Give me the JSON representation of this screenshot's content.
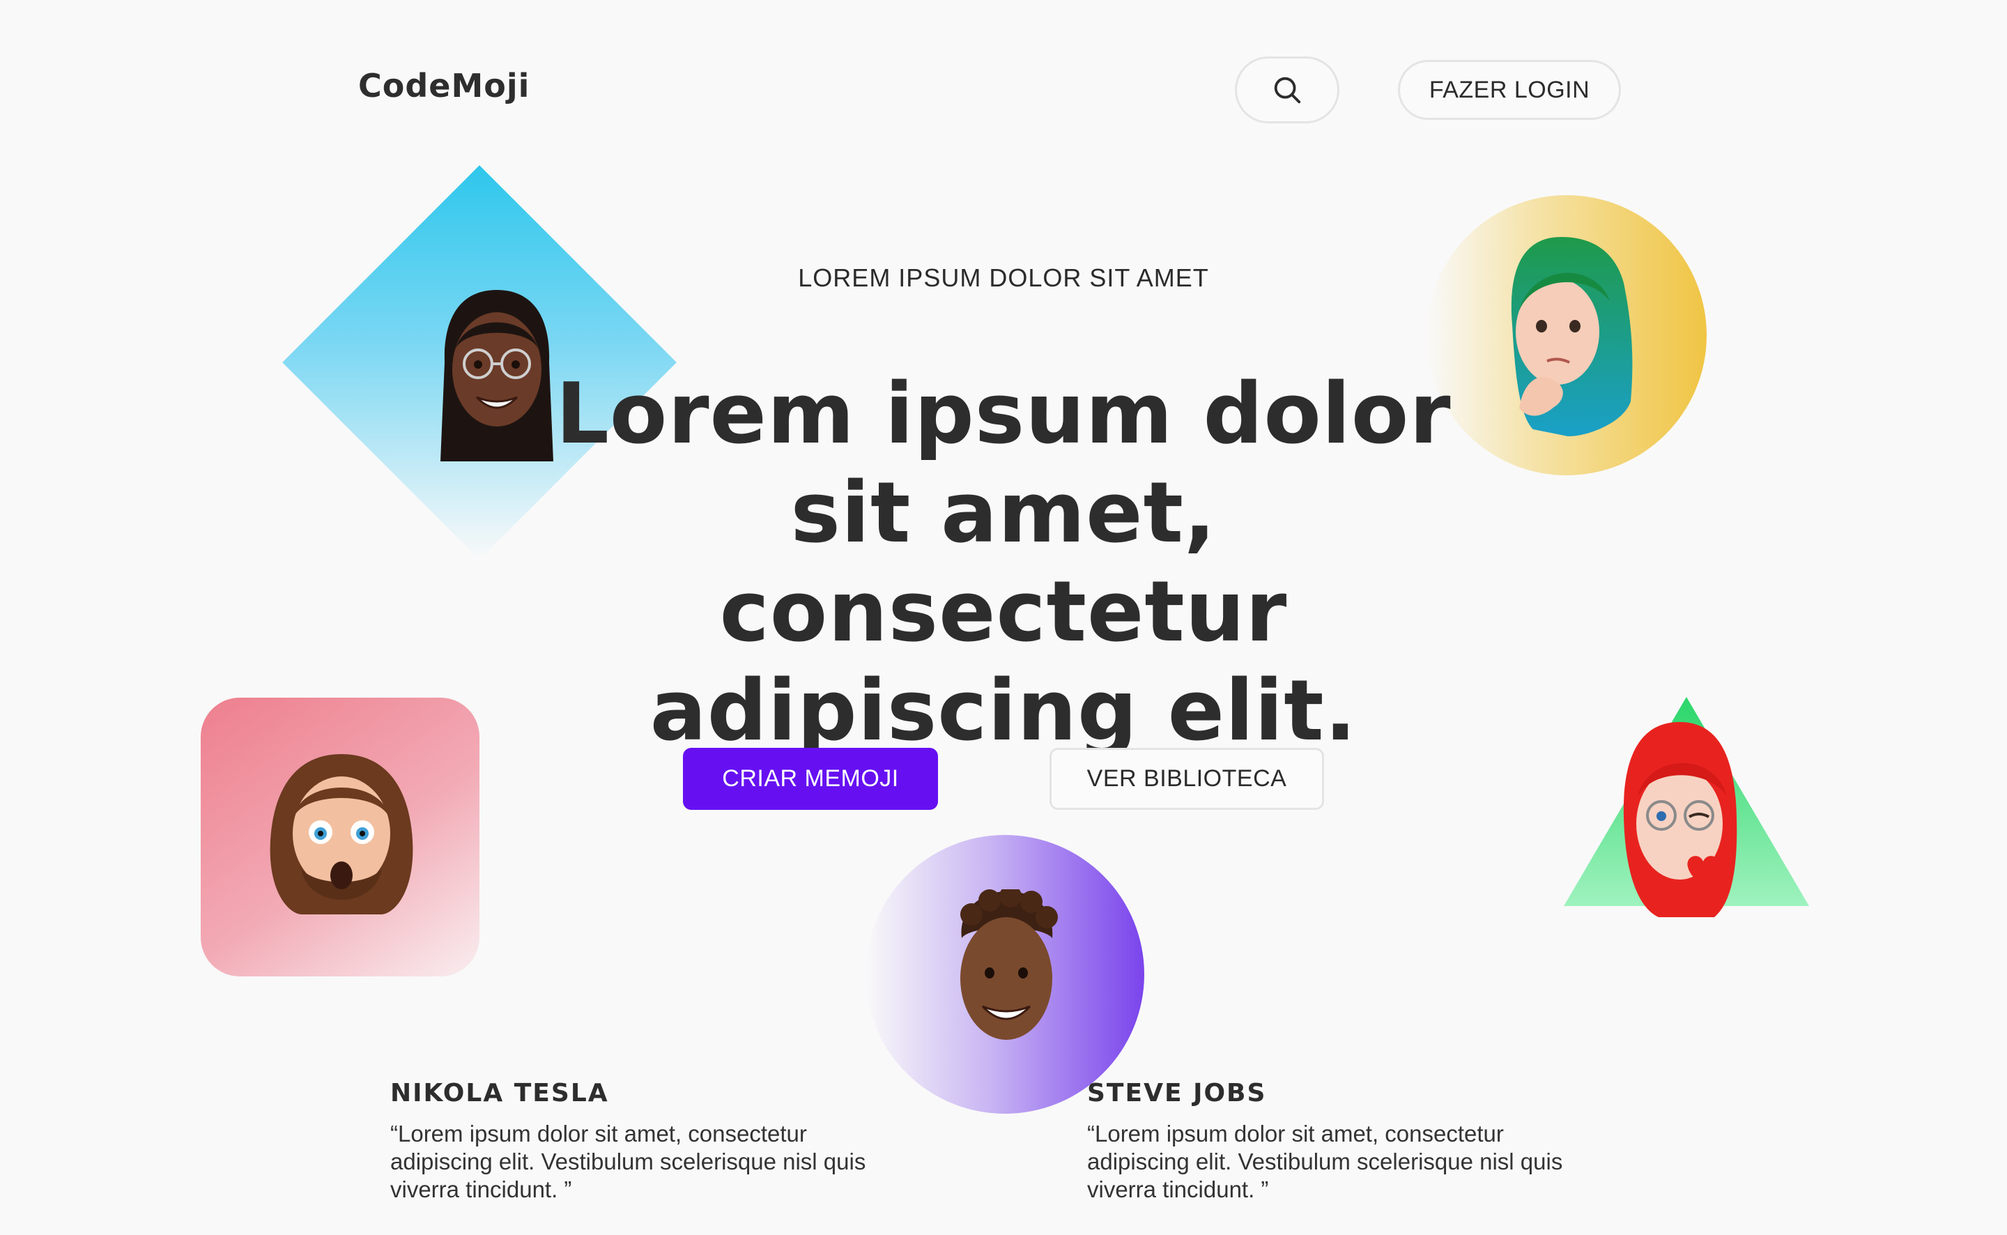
{
  "header": {
    "logo": "CodeMoji",
    "search_icon": "search-icon",
    "login_label": "FAZER LOGIN"
  },
  "hero": {
    "kicker": "LOREM IPSUM DOLOR SIT AMET",
    "headline": "Lorem ipsum dolor sit amet, consectetur adipiscing elit.",
    "primary_cta": "CRIAR MEMOJI",
    "secondary_cta": "VER BIBLIOTECA"
  },
  "colors": {
    "accent": "#6610f2",
    "text": "#2d2d2d",
    "background": "#f9f9f9"
  },
  "testimonials": [
    {
      "name": "NIKOLA TESLA",
      "quote_lines": [
        "“Lorem ipsum dolor sit amet, consectetur",
        "adipiscing elit. Vestibulum scelerisque nisl quis",
        "viverra tincidunt. ”"
      ]
    },
    {
      "name": "STEVE JOBS",
      "quote_lines": [
        "“Lorem ipsum dolor sit amet, consectetur",
        "adipiscing elit. Vestibulum scelerisque nisl quis",
        "viverra tincidunt. ”"
      ]
    }
  ]
}
